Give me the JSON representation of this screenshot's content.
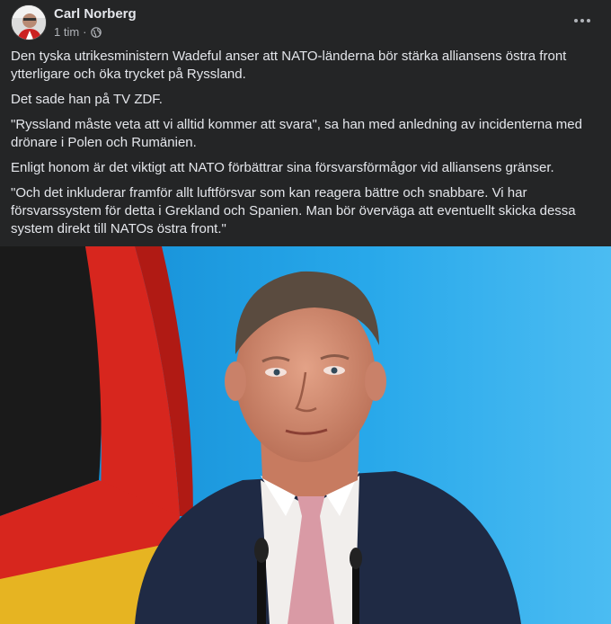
{
  "post": {
    "author": "Carl Norberg",
    "time": "1 tim",
    "separator": "·",
    "privacy_icon": "globe-icon",
    "more_icon": "more-options-icon",
    "paragraphs": [
      "Den tyska utrikesministern Wadeful anser att NATO-länderna bör stärka alliansens östra front ytterligare och öka trycket på Ryssland.",
      "Det sade han på TV ZDF.",
      "\"Ryssland måste veta att vi alltid kommer att svara\", sa han med anledning av incidenterna med drönare i Polen och Rumänien.",
      "Enligt honom är det viktigt att NATO förbättrar sina försvarsförmågor vid alliansens gränser.",
      "\"Och det inkluderar framför allt luftförsvar som kan reagera bättre och snabbare. Vi har försvarssystem för detta i Grekland och Spanien. Man bör överväga att eventuellt skicka dessa system direkt till NATOs östra front.\""
    ]
  },
  "colors": {
    "background": "#242526",
    "text_primary": "#e4e6eb",
    "text_secondary": "#b0b3b8",
    "photo_backdrop_blue": "#1aa0e6",
    "flag_black": "#1a1a1a",
    "flag_red": "#d7261e",
    "flag_gold": "#e6b422"
  }
}
